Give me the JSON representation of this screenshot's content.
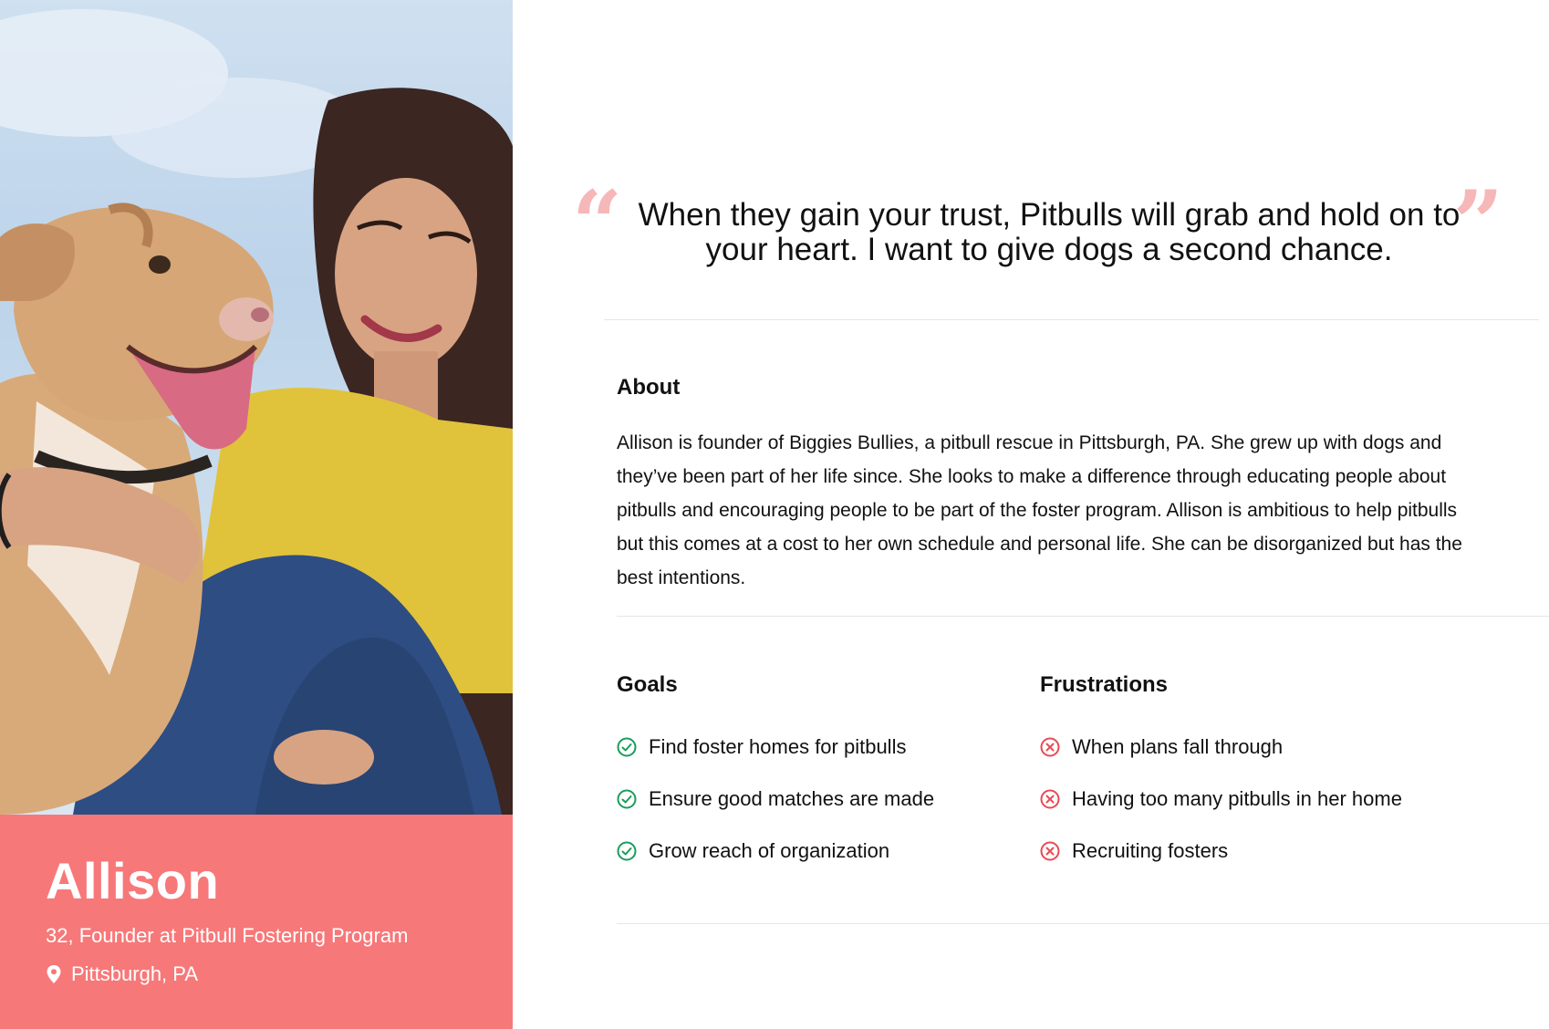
{
  "persona": {
    "name": "Allison",
    "role": "32, Founder at Pitbull Fostering Program",
    "location": "Pittsburgh, PA",
    "location_icon": "map-pin-icon",
    "photo": "woman-with-dog-photo"
  },
  "quote": {
    "open_mark": "“",
    "close_mark": "”",
    "text": "When they gain your trust, Pitbulls will grab and hold on to your heart. I want to give dogs a second chance."
  },
  "about": {
    "title": "About",
    "text": "Allison is founder of Biggies Bullies, a pitbull rescue in Pittsburgh, PA. She grew up with dogs and they’ve been part of her life since. She looks to make a difference through educating people about pitbulls and encouraging people to be part of the foster program. Allison is ambitious to help pitbulls but this comes at a cost to her own schedule and personal life. She can be disorganized but has the best intentions."
  },
  "goals": {
    "title": "Goals",
    "icon": "check-circle-icon",
    "items": [
      "Find foster homes for pitbulls",
      "Ensure good matches are made",
      "Grow reach of organization"
    ]
  },
  "frustrations": {
    "title": "Frustrations",
    "icon": "x-circle-icon",
    "items": [
      "When plans fall through",
      "Having too many pitbulls in her home",
      "Recruiting fosters"
    ]
  },
  "colors": {
    "accent": "#f77879",
    "quote_mark": "#f6b7b8",
    "check_green": "#1a9c5b",
    "x_red": "#e84a55",
    "divider": "#e6e6e6"
  }
}
